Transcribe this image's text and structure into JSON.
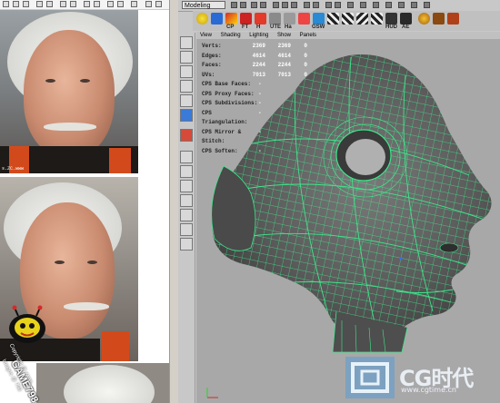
{
  "left_panel": {
    "photo_caption": "s.ZC.www",
    "logo_text": "GAME798",
    "copyright_line1": "Copyright @ www.",
    "copyright_line2": "Images @ 798"
  },
  "maya": {
    "mode_select": "Modeling",
    "shelf_labels": [
      "CP",
      "FT",
      "H ",
      "UTE",
      "Ha ",
      "GSW",
      "HUD",
      "AE"
    ],
    "viewport_menu": [
      "View",
      "Shading",
      "Lighting",
      "Show",
      "Panels"
    ],
    "hud": {
      "rows": [
        {
          "label": "Verts:",
          "v1": "2369",
          "v2": "2369",
          "v3": "0"
        },
        {
          "label": "Edges:",
          "v1": "4614",
          "v2": "4614",
          "v3": "0"
        },
        {
          "label": "Faces:",
          "v1": "2244",
          "v2": "2244",
          "v3": "0"
        },
        {
          "label": "UVs:",
          "v1": "7013",
          "v2": "7013",
          "v3": "0"
        }
      ],
      "cps": [
        {
          "label": "CPS Base Faces:",
          "v": "-"
        },
        {
          "label": "CPS Proxy Faces:",
          "v": "-"
        },
        {
          "label": "CPS Subdivisions:",
          "v": "-"
        },
        {
          "label": "CPS Triangulation:",
          "v": "-"
        },
        {
          "label": "CPS Mirror & Stitch:",
          "v": "-"
        },
        {
          "label": "CPS Soften:",
          "v": "-"
        }
      ]
    },
    "axis_label": "x",
    "mesh_color": "#3ee68a",
    "surface_color": "#5a5a5a"
  },
  "watermark": {
    "text": "CG时代",
    "url": "www.cgtime.cn"
  }
}
